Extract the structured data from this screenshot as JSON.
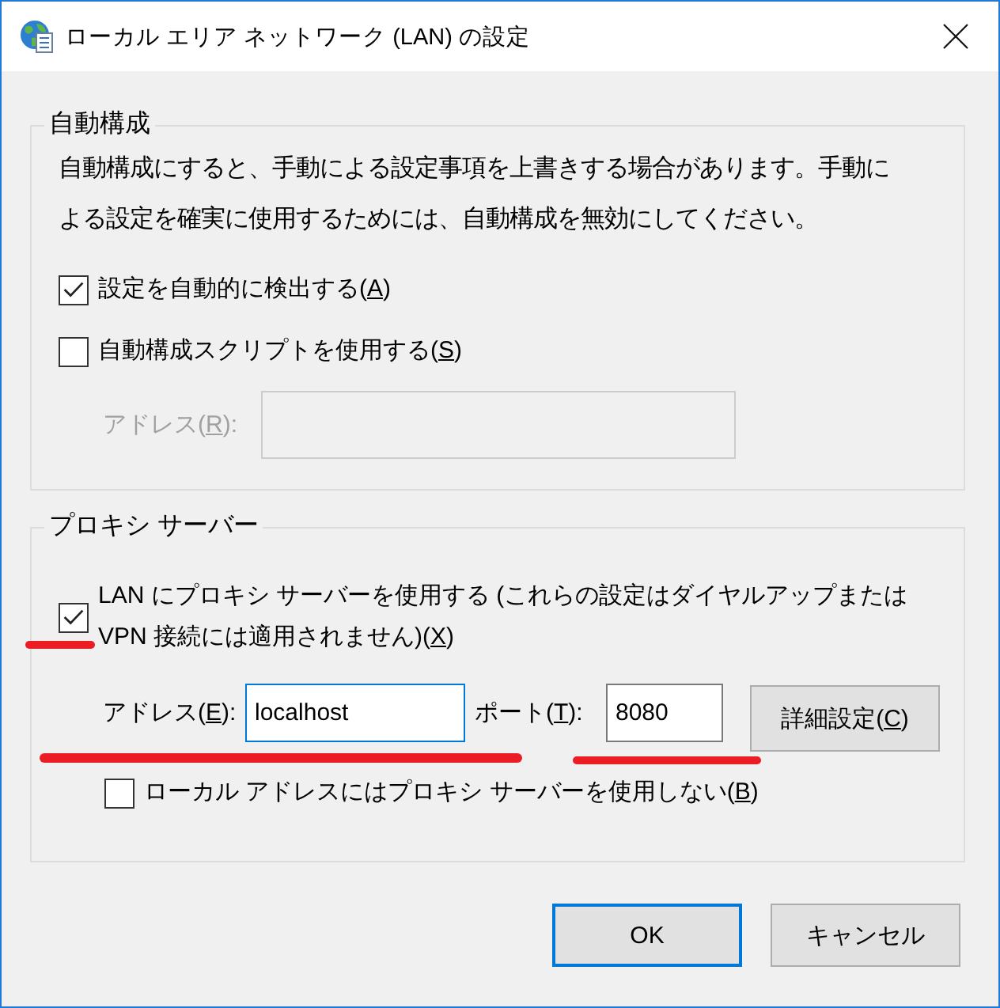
{
  "window": {
    "title": "ローカル エリア ネットワーク (LAN) の設定"
  },
  "auto_config": {
    "legend": "自動構成",
    "description": "自動構成にすると、手動による設定事項を上書きする場合があります。手動による設定を確実に使用するためには、自動構成を無効にしてください。",
    "checkboxes": [
      {
        "label": "設定を自動的に検出する(",
        "access_key": "A",
        "label_end": ")",
        "checked": true
      },
      {
        "label": "自動構成スクリプトを使用する(",
        "access_key": "S",
        "label_end": ")",
        "checked": false
      }
    ],
    "script_address": {
      "label": "アドレス(",
      "access_key": "R",
      "label_end": "):",
      "disabled": true
    }
  },
  "proxy": {
    "legend": "プロキシ サーバー",
    "use_proxy": {
      "label": "LAN にプロキシ サーバーを使用する (これらの設定はダイヤルアップまたは VPN 接続には適用されません)(",
      "access_key": "X",
      "label_end": ")",
      "checked": true,
      "marked": true
    },
    "address": {
      "label": "アドレス(",
      "access_key": "E",
      "label_end": "):",
      "value": "localhost",
      "focused": true,
      "marked": true
    },
    "port": {
      "label": "ポート(",
      "access_key": "T",
      "label_end": "):",
      "value": "8080",
      "focused": false,
      "marked": true
    },
    "advanced_button": {
      "label": "詳細設定(",
      "access_key": "C",
      "label_end": ")"
    },
    "bypass_local": {
      "label": "ローカル アドレスにはプロキシ サーバーを使用しない(",
      "access_key": "B",
      "label_end": ")",
      "checked": false
    }
  },
  "buttons": [
    {
      "label": "OK",
      "default": true
    },
    {
      "label": "キャンセル",
      "default": false
    }
  ]
}
